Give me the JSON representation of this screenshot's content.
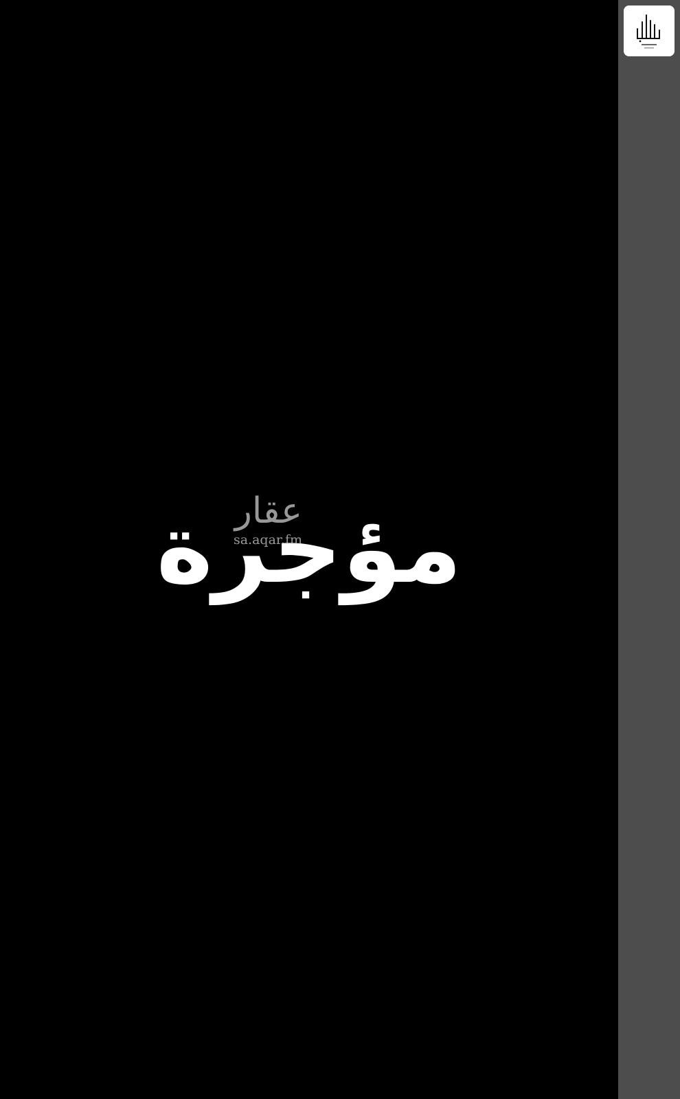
{
  "photo": {
    "status_text": "مؤجرة",
    "background_color": "#000000",
    "text_color": "#ffffff"
  },
  "watermark": {
    "arabic_text": "عقار",
    "url_text": "sa.aqar.fm"
  },
  "side_panel": {
    "background_color": "#4d4d4d"
  }
}
